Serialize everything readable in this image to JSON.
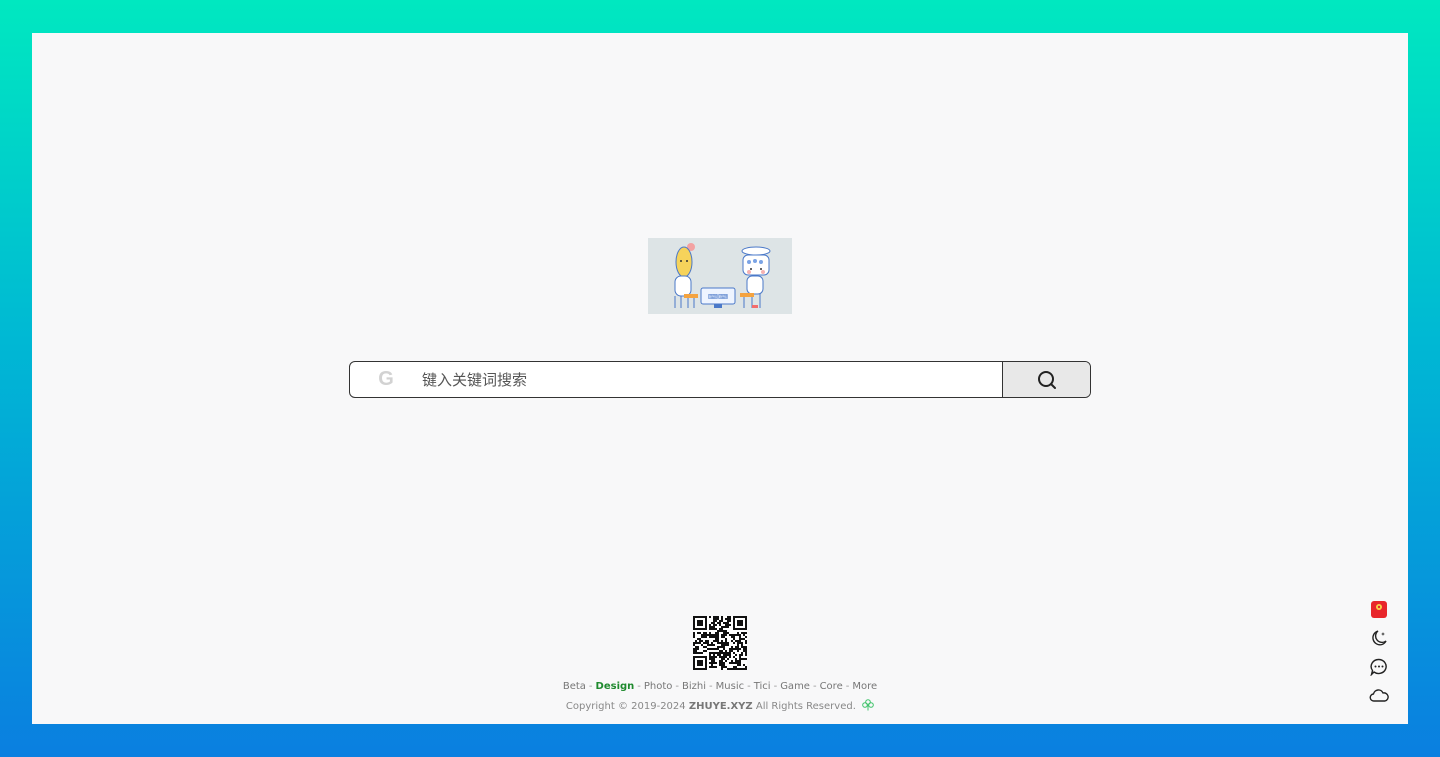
{
  "search": {
    "engine_icon": "google-icon",
    "engine_letter": "G",
    "placeholder": "键入关键词搜索",
    "submit_icon": "search-icon"
  },
  "footer": {
    "links": [
      {
        "label": "Beta"
      },
      {
        "label": "Design",
        "active": true
      },
      {
        "label": "Photo"
      },
      {
        "label": "Bizhi"
      },
      {
        "label": "Music"
      },
      {
        "label": "Tici"
      },
      {
        "label": "Game"
      },
      {
        "label": "Core"
      },
      {
        "label": "More"
      }
    ],
    "separator": "-",
    "copyright_prefix": "Copyright © 2019-2024",
    "copyright_site": "ZHUYE.XYZ",
    "copyright_suffix": "All Rights Reserved."
  },
  "side_tools": [
    "red-envelope-icon",
    "moon-icon",
    "chat-icon",
    "cloud-icon"
  ],
  "colors": {
    "accent_green": "#1f8a2e",
    "background_top": "#00e8c0",
    "background_bottom": "#0a7fe0"
  }
}
